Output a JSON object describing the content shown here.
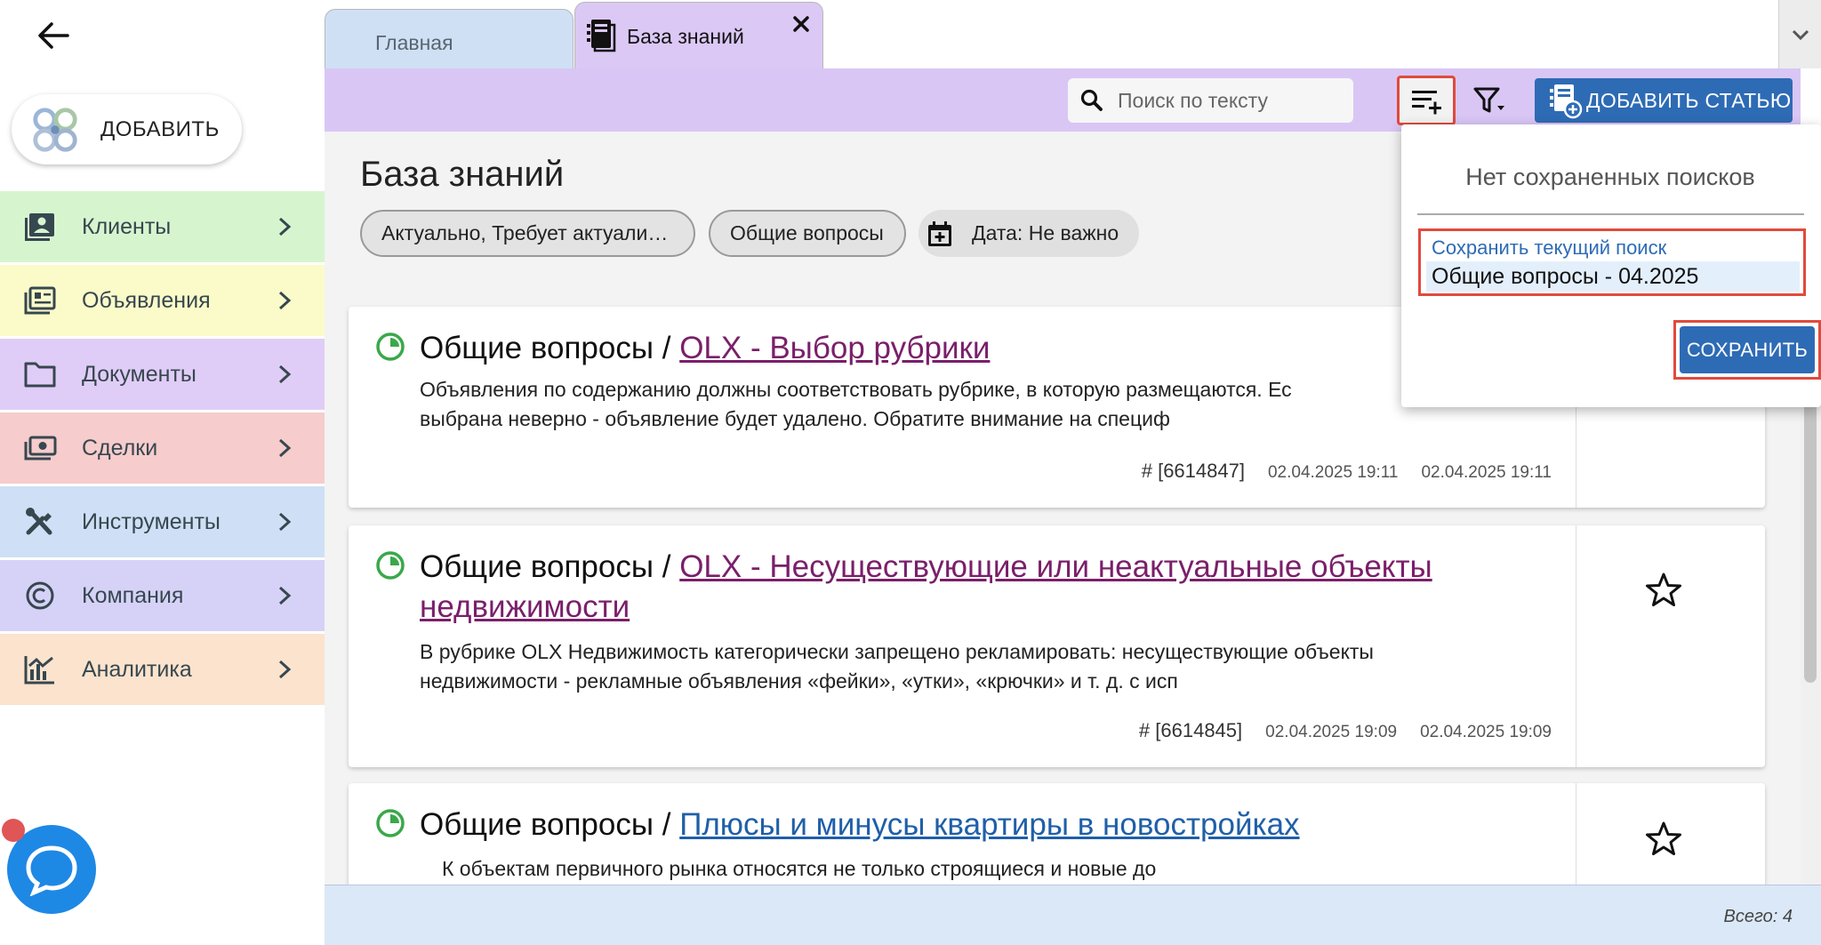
{
  "sidebar": {
    "add_label": "ДОБАВИТЬ",
    "items": [
      {
        "label": "Клиенты",
        "bg": "#d6f5cf",
        "icon": "contacts-icon"
      },
      {
        "label": "Объявления",
        "bg": "#fbfbc9",
        "icon": "listing-icon"
      },
      {
        "label": "Документы",
        "bg": "#e0cdf7",
        "icon": "folder-icon"
      },
      {
        "label": "Сделки",
        "bg": "#f6cccc",
        "icon": "money-icon"
      },
      {
        "label": "Инструменты",
        "bg": "#cfe0f6",
        "icon": "tools-icon"
      },
      {
        "label": "Компания",
        "bg": "#d6d2f7",
        "icon": "copyright-icon"
      },
      {
        "label": "Аналитика",
        "bg": "#fbe3cd",
        "icon": "analytics-icon"
      }
    ]
  },
  "tabs": [
    {
      "label": "Главная"
    },
    {
      "label": "База знаний"
    }
  ],
  "toolbar": {
    "search_placeholder": "Поиск по тексту",
    "add_article_label": "ДОБАВИТЬ СТАТЬЮ"
  },
  "main": {
    "title": "База знаний",
    "chips": {
      "status": "Актуально, Требует актуализ…",
      "category": "Общие вопросы",
      "date": "Дата: Не важно"
    },
    "articles": [
      {
        "category": "Общие вопросы / ",
        "link": "OLX - Выбор рубрики",
        "desc": "Объявления по содержанию должны соответствовать рубрике, в которую размещаются. Ес",
        "desc2": "выбрана неверно - объявление будет удалено. Обратите внимание на специф",
        "id": "# [6614847]",
        "created": "02.04.2025 19:11",
        "updated": "02.04.2025 19:11"
      },
      {
        "category": "Общие вопросы / ",
        "link": "OLX - Несуществующие или неактуальные объекты недвижимости",
        "desc": "В рубрике OLX Недвижимость категорически запрещено рекламировать: несуществующие объекты",
        "desc2": "недвижимости - рекламные объявления «фейки», «утки», «крючки» и т. д. с исп",
        "id": "# [6614845]",
        "created": "02.04.2025 19:09",
        "updated": "02.04.2025 19:09"
      },
      {
        "category": "Общие вопросы / ",
        "link": "Плюсы и минусы квартиры в новостройках",
        "desc": "К объектам первичного рынка относятся не только строящиеся и новые до"
      }
    ]
  },
  "footer": {
    "total": "Всего: 4"
  },
  "popover": {
    "empty_text": "Нет сохраненных поисков",
    "field_label": "Сохранить текущий поиск",
    "field_value": "Общие вопросы - 04.2025",
    "save_label": "СОХРАНИТЬ"
  },
  "colors": {
    "accent": "#2e6bb5",
    "highlight": "#e04a3c",
    "toolbar": "#d9c6f5",
    "link_visited": "#7a1f6a",
    "link": "#1f5fa8",
    "status_green": "#3aa84a"
  }
}
